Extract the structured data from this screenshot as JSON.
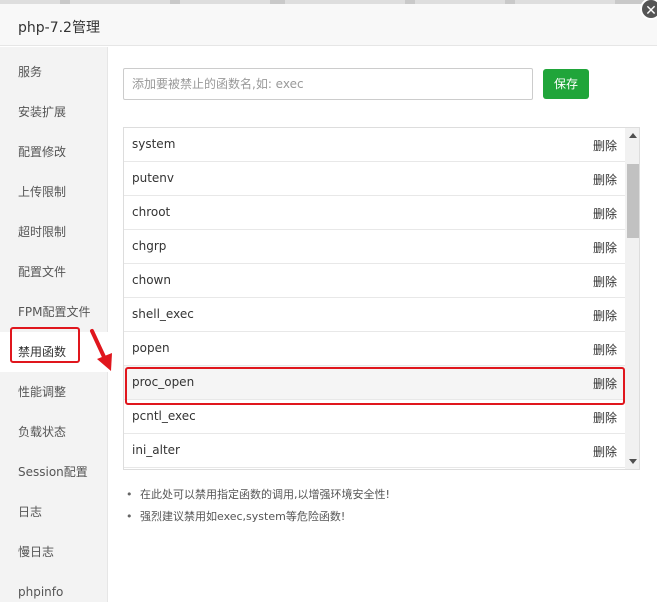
{
  "window": {
    "title": "php-7.2管理",
    "close_glyph": "✕"
  },
  "sidebar": {
    "items": [
      {
        "label": "服务"
      },
      {
        "label": "安装扩展"
      },
      {
        "label": "配置修改"
      },
      {
        "label": "上传限制"
      },
      {
        "label": "超时限制"
      },
      {
        "label": "配置文件"
      },
      {
        "label": "FPM配置文件"
      },
      {
        "label": "禁用函数",
        "active": true
      },
      {
        "label": "性能调整"
      },
      {
        "label": "负载状态"
      },
      {
        "label": "Session配置"
      },
      {
        "label": "日志"
      },
      {
        "label": "慢日志"
      },
      {
        "label": "phpinfo"
      }
    ]
  },
  "form": {
    "input_placeholder": "添加要被禁止的函数名,如: exec",
    "input_value": "",
    "save_label": "保存"
  },
  "functions": {
    "delete_label": "删除",
    "rows": [
      {
        "name": "system"
      },
      {
        "name": "putenv"
      },
      {
        "name": "chroot"
      },
      {
        "name": "chgrp"
      },
      {
        "name": "chown"
      },
      {
        "name": "shell_exec"
      },
      {
        "name": "popen"
      },
      {
        "name": "proc_open",
        "highlighted": true
      },
      {
        "name": "pcntl_exec"
      },
      {
        "name": "ini_alter"
      }
    ]
  },
  "notes": [
    "在此处可以禁用指定函数的调用,以增强环境安全性!",
    "强烈建议禁用如exec,system等危险函数!"
  ],
  "colors": {
    "accent": "#20a53a",
    "annotation": "#e0161d"
  }
}
